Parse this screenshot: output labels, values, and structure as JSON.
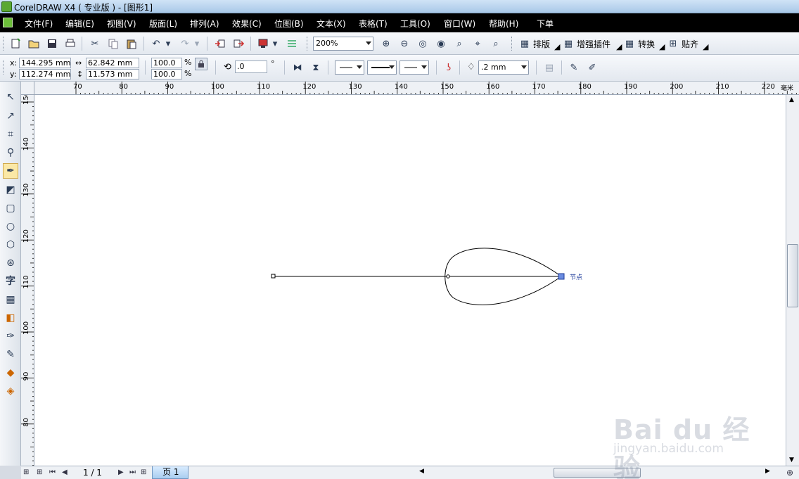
{
  "window": {
    "title": "CorelDRAW X4 ( 专业版 ) - [图形1]"
  },
  "menu": [
    "文件(F)",
    "编辑(E)",
    "视图(V)",
    "版面(L)",
    "排列(A)",
    "效果(C)",
    "位图(B)",
    "文本(X)",
    "表格(T)",
    "工具(O)",
    "窗口(W)",
    "帮助(H)",
    "下单"
  ],
  "standard_toolbar": {
    "zoom": "200%",
    "plugins": [
      "排版",
      "增强插件",
      "转换",
      "贴齐"
    ]
  },
  "property_bar": {
    "x": "144.295 mm",
    "y": "112.274 mm",
    "width": "62.842 mm",
    "height": "11.573 mm",
    "scale_x": "100.0",
    "scale_y": "100.0",
    "percent": "%",
    "rotation": ".0",
    "degree": "°",
    "outline_width": ".2 mm"
  },
  "ruler": {
    "h_labels": [
      "70",
      "80",
      "90",
      "100",
      "110",
      "120",
      "130",
      "140",
      "150",
      "160",
      "170",
      "180",
      "190",
      "200",
      "210",
      "220"
    ],
    "h_unit": "毫米",
    "v_labels": [
      "150",
      "140",
      "130",
      "120",
      "110",
      "100",
      "90",
      "80"
    ]
  },
  "canvas": {
    "node_label": "节点"
  },
  "pagebar": {
    "page_count": "1 / 1",
    "page_tab": "页 1"
  },
  "watermark": {
    "brand": "Bai du 经验",
    "url": "jingyan.baidu.com"
  },
  "tools": [
    "pick-tool",
    "shape-tool",
    "crop-tool",
    "zoom-tool",
    "freehand-tool",
    "smart-fill-tool",
    "rectangle-tool",
    "ellipse-tool",
    "polygon-tool",
    "basic-shapes-tool",
    "text-tool",
    "table-tool",
    "interactive-blend-tool",
    "eyedropper-tool",
    "outline-tool",
    "fill-tool",
    "interactive-fill-tool"
  ]
}
